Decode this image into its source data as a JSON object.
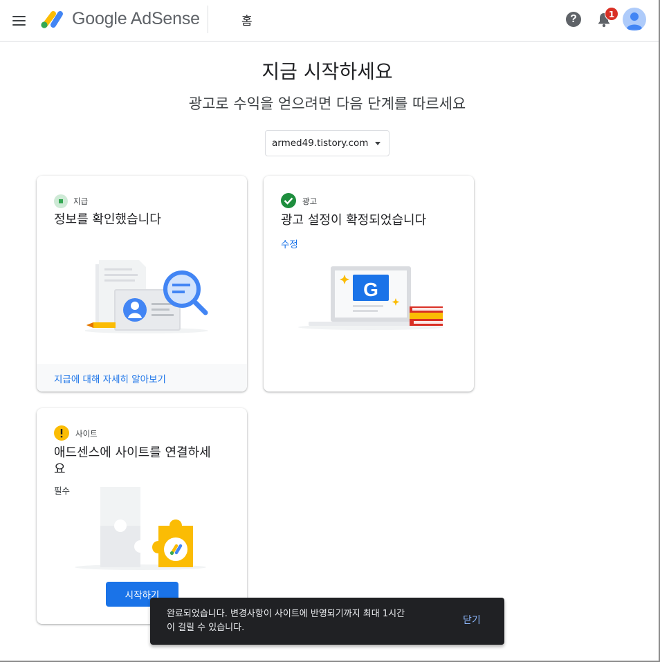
{
  "header": {
    "brand": "Google AdSense",
    "page_tab": "홈",
    "help_icon": "help-circle-icon",
    "notification_icon": "bell-icon",
    "notification_count": "1",
    "avatar_icon": "account-avatar-icon"
  },
  "main": {
    "title": "지금 시작하세요",
    "subtitle": "광고로 수익을 얻으려면 다음 단계를 따르세요",
    "site_select": {
      "value": "armed49.tistory.com"
    }
  },
  "cards": {
    "payment": {
      "label": "지급",
      "title": "정보를 확인했습니다",
      "footer_link": "지급에 대해 자세히 알아보기",
      "status": "in-progress",
      "status_color": "#34a853"
    },
    "ads": {
      "label": "광고",
      "title": "광고 설정이 확정되었습니다",
      "link": "수정",
      "status": "complete",
      "status_color": "#1e8e3e"
    },
    "site": {
      "label": "사이트",
      "title_line1": "애드센스에 사이트를 연결하세",
      "title_line2": "요",
      "required": "필수",
      "button": "시작하기",
      "status": "warning",
      "status_color": "#fbbc04"
    }
  },
  "snackbar": {
    "line1": "완료되었습니다. 변경사항이 사이트에 반영되기까지 최대 1시간",
    "line2": "이 걸릴 수 있습니다.",
    "close": "닫기"
  },
  "colors": {
    "accent": "#1a73e8",
    "badge": "#d93025",
    "snackbar_bg": "#202124"
  }
}
